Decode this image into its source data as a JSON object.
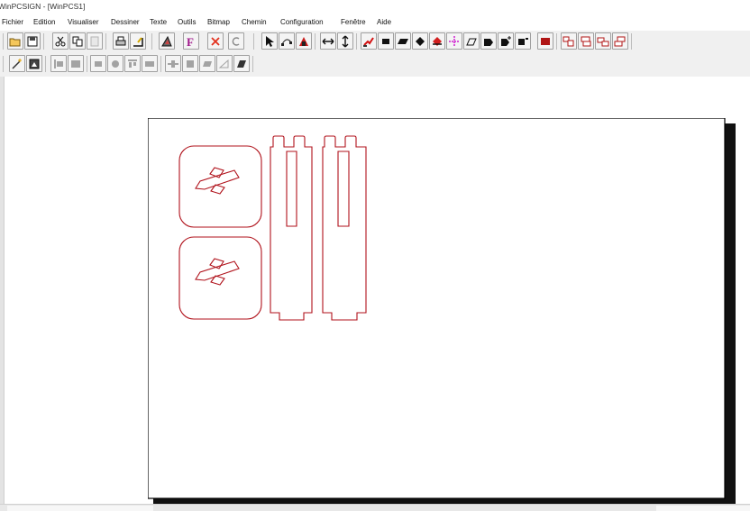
{
  "window": {
    "title": "WinPCSIGN - [WinPCS1]"
  },
  "menu": {
    "items": [
      "Fichier",
      "Edition",
      "Visualiser",
      "Dessiner",
      "Texte",
      "Outils",
      "Bitmap",
      "Chemin",
      "Configuration",
      "Fenêtre",
      "Aide"
    ]
  },
  "toolbar_main": {
    "buttons": [
      {
        "icon": "open-folder-icon"
      },
      {
        "icon": "save-icon"
      },
      {
        "icon": "cut-icon"
      },
      {
        "icon": "copy-icon"
      },
      {
        "icon": "paste-icon"
      },
      {
        "icon": "print-icon"
      },
      {
        "icon": "cutter-output-icon"
      },
      {
        "icon": "plotter-icon"
      },
      {
        "icon": "text-f-icon",
        "text": "F"
      },
      {
        "icon": "delete-x-icon"
      },
      {
        "icon": "undo-icon"
      },
      {
        "icon": "pointer-arrow-icon"
      },
      {
        "icon": "node-edit-icon"
      },
      {
        "icon": "red-tool-icon"
      },
      {
        "icon": "horizontal-arrows-icon"
      },
      {
        "icon": "vertical-arrows-icon"
      },
      {
        "icon": "red-pen-icon"
      },
      {
        "icon": "black-rectangle-icon"
      },
      {
        "icon": "parallelogram-icon"
      },
      {
        "icon": "diamond-icon"
      },
      {
        "icon": "red-diamond-icon"
      },
      {
        "icon": "magenta-crosshair-icon"
      },
      {
        "icon": "outline-shape-icon"
      },
      {
        "icon": "black-arrow-shape-icon"
      },
      {
        "icon": "arrow-plus-icon"
      },
      {
        "icon": "black-flag-icon"
      },
      {
        "icon": "red-block-icon"
      },
      {
        "icon": "window-group-1-icon"
      },
      {
        "icon": "window-group-2-icon"
      },
      {
        "icon": "window-group-3-icon"
      },
      {
        "icon": "window-group-4-icon"
      }
    ]
  },
  "toolbar_secondary": {
    "buttons": [
      {
        "icon": "magic-wand-icon"
      },
      {
        "icon": "image-edit-icon"
      },
      {
        "icon": "align-left-icon"
      },
      {
        "icon": "align-block-icon"
      },
      {
        "icon": "align-center-icon"
      },
      {
        "icon": "circle-center-icon"
      },
      {
        "icon": "align-top-icon"
      },
      {
        "icon": "align-middle-icon"
      },
      {
        "icon": "distribute-h-icon"
      },
      {
        "icon": "distribute-v-icon"
      },
      {
        "icon": "skew-icon"
      },
      {
        "icon": "triangle-icon"
      },
      {
        "icon": "dark-skew-icon"
      }
    ]
  },
  "colors": {
    "cut_line": "#b0121b",
    "page_border": "#000000",
    "shadow": "#111111",
    "canvas": "#ffffff"
  }
}
